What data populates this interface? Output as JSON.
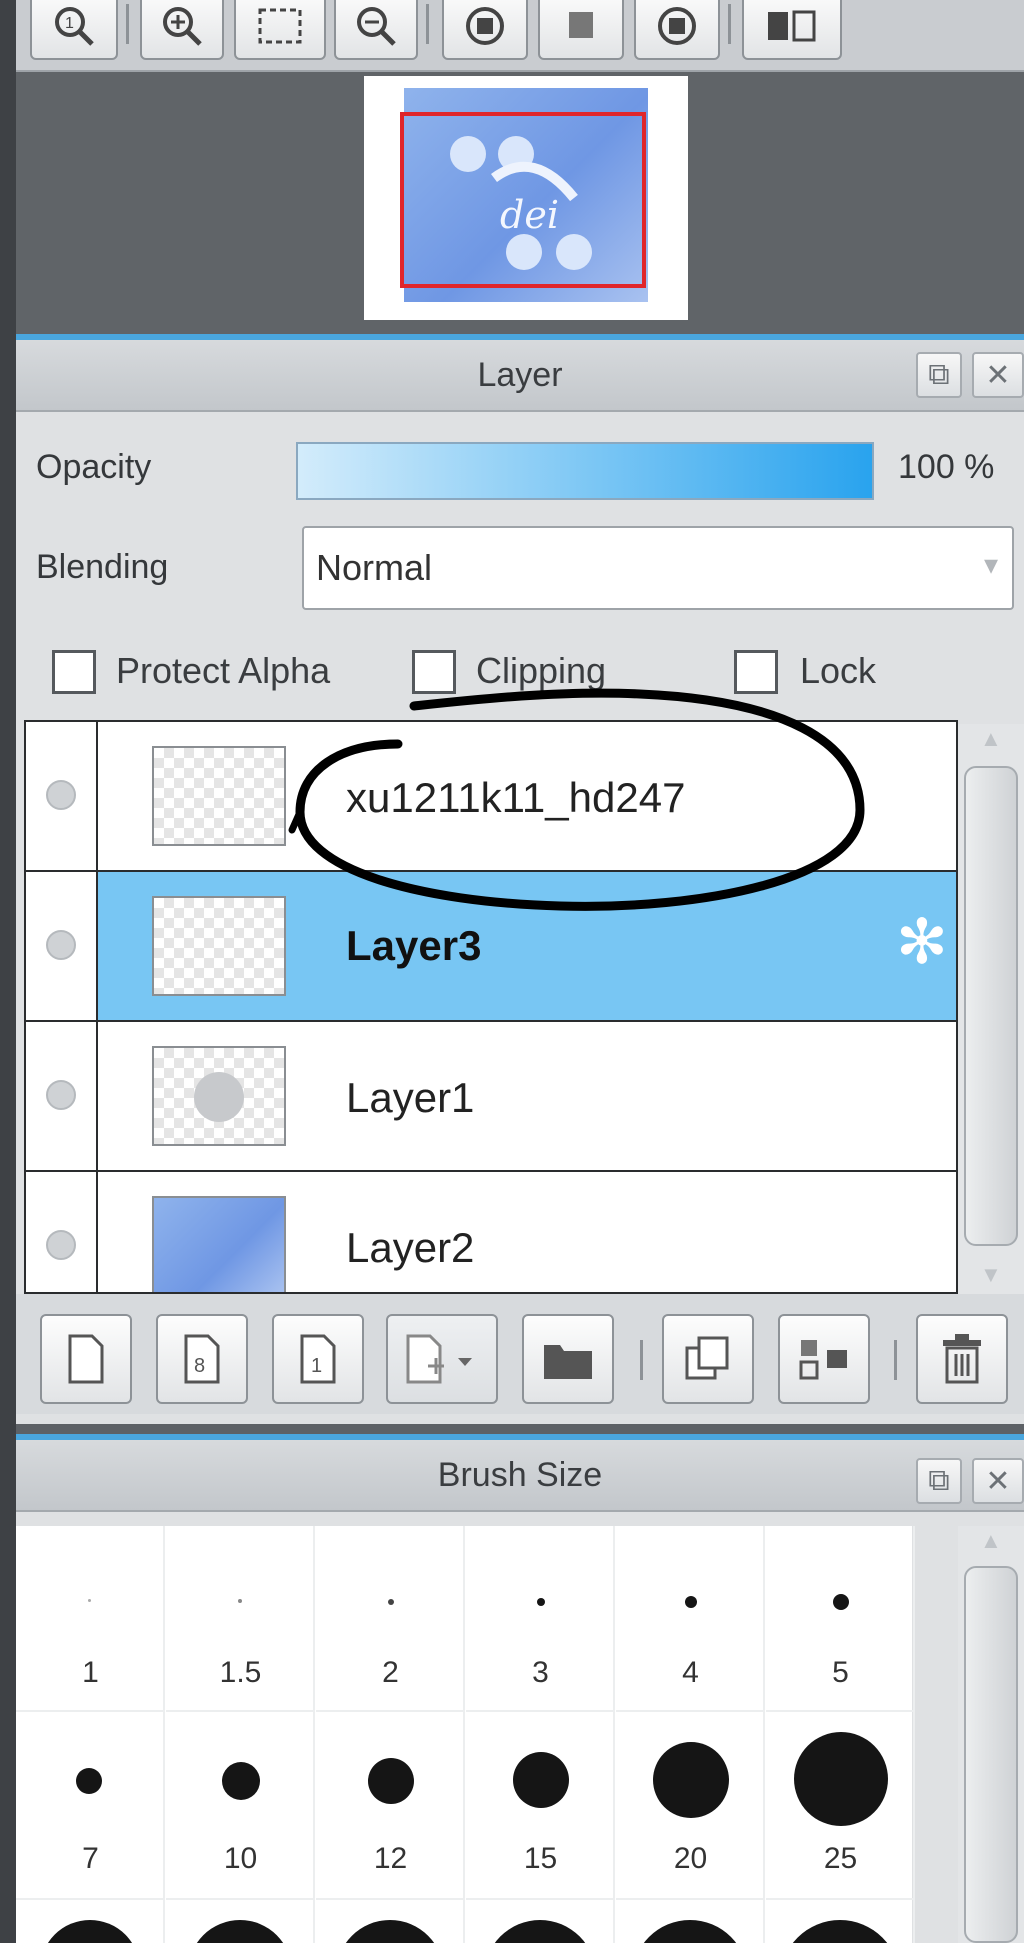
{
  "layer_panel": {
    "title": "Layer",
    "opacity_label": "Opacity",
    "opacity_value": "100 %",
    "opacity_fraction": 1.0,
    "blending_label": "Blending",
    "blending_value": "Normal",
    "protect_alpha_label": "Protect Alpha",
    "clipping_label": "Clipping",
    "lock_label": "Lock",
    "layers": [
      {
        "name": "xu1211k11_hd247",
        "selected": false
      },
      {
        "name": "Layer3",
        "selected": true
      },
      {
        "name": "Layer1",
        "selected": false
      },
      {
        "name": "Layer2",
        "selected": false
      }
    ]
  },
  "brush_panel": {
    "title": "Brush Size",
    "sizes": [
      "1",
      "1.5",
      "2",
      "3",
      "4",
      "5",
      "7",
      "10",
      "12",
      "15",
      "20",
      "25"
    ]
  },
  "colors": {
    "selection": "#78c6f3",
    "accent": "#4aa6de",
    "navigator_frame": "#e0262b",
    "annotation_ink": "#000000"
  }
}
